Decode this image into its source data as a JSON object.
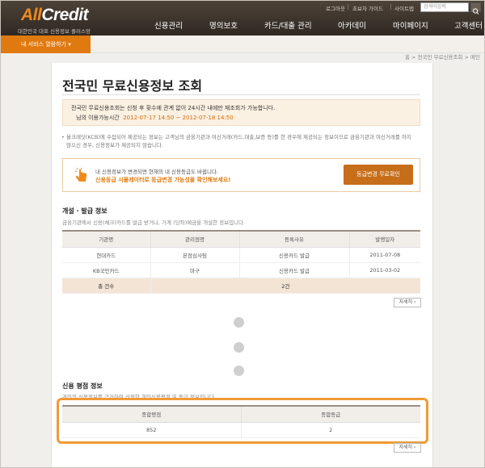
{
  "header": {
    "logo_prefix": "All",
    "logo_suffix": "Credit",
    "logo_sub": "대한민국 대표 신용정보 플러스망",
    "util_links": [
      "로그아웃",
      "초보자 가이드",
      "사이트맵"
    ],
    "search_placeholder": "검색어입력",
    "nav": [
      "신용관리",
      "명의보호",
      "카드/대출 관리",
      "아카데미",
      "마이페이지",
      "고객센터"
    ]
  },
  "subbar": {
    "service_label": "내 서비스 열람하기 ▾",
    "breadcrumb": "홈 > 전국민 무료신용조회 > 메인"
  },
  "page": {
    "title": "전국민 무료신용정보 조회"
  },
  "notice": {
    "line1": "전국민 무료신용조회는 신청 후 횟수에 관계 없이 24시간 내에만 재조회가 가능합니다.",
    "line2_prefix": "님의 이용가능시간",
    "line2_date": "2012-07-17 14:50 ~ 2012-07-18 14:50"
  },
  "info_text": "올크레딧(KCB)에 수집되어 제공되는 정보는 고객님의 금융기관과 여신거래(카드,대출,보증 등)를 한 경우에 제공되는 정보이므로 금융기관과 여신거래를 하지 않으신 경우, 신용정보가 제공되지 않습니다.",
  "promo": {
    "line1": "내 신용정보가 변경되면 현재의 내 신용등급도 바뀝니다.",
    "line2": "신용등급 시뮬레이터로 등급변경 가능성을 확인해보세요!",
    "button": "등급변경 무료확인"
  },
  "issue_section": {
    "title": "개설 · 발급 정보",
    "desc": "금융기관에서 신용(체크)카드를 발급 받거나, 가계 (당좌)예금을 개설한 정보입니다.",
    "columns": [
      "기관명",
      "관리점명",
      "등록사유",
      "발행일자"
    ],
    "rows": [
      [
        "현대카드",
        "본점심사팀",
        "신용카드 발급",
        "2011-07-08"
      ],
      [
        "KB국민카드",
        "마구",
        "신용카드 발급",
        "2011-03-02"
      ]
    ],
    "total_label": "총 건수",
    "total_value": "2건",
    "more": "자세히 ›"
  },
  "score_section": {
    "title": "신용 평점 정보",
    "desc": "개인의 신용정보를 근거하여 산정한 개인신용평점 및 등급 정보입니다.",
    "columns": [
      "종합평점",
      "종합등급"
    ],
    "values": [
      "852",
      "2"
    ],
    "more": "자세히 ›"
  }
}
